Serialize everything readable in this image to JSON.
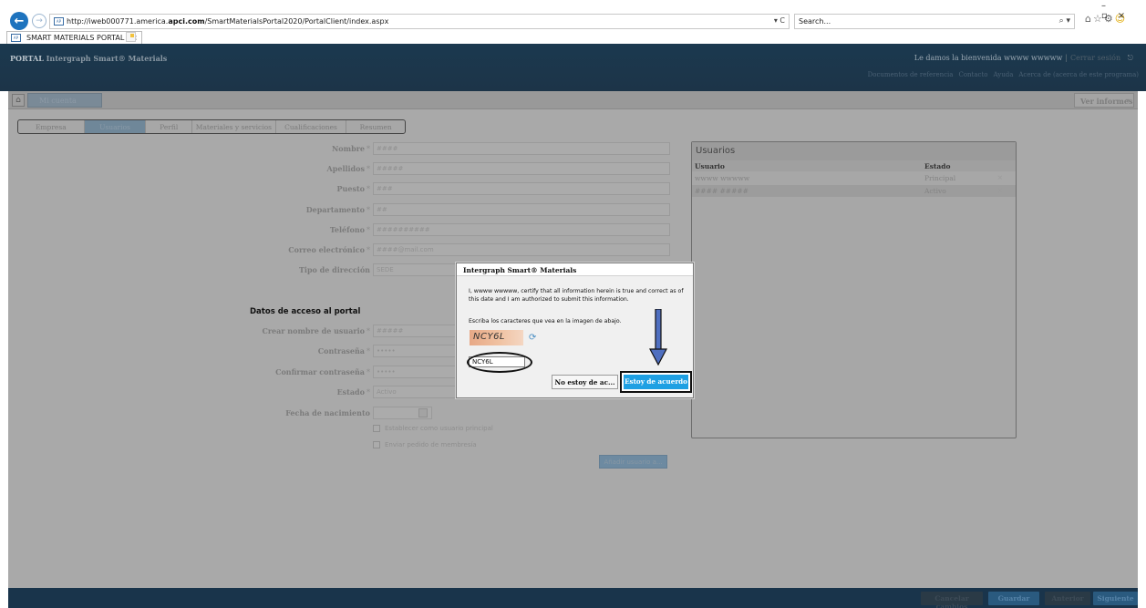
{
  "browser": {
    "url_prefix": "http://iweb000771.america.",
    "url_domain": "apci.com",
    "url_path": "/SmartMaterialsPortal2020/PortalClient/index.aspx",
    "url_controls": "▾ C",
    "search_placeholder": "Search...",
    "tab_title": "SMART MATERIALS PORTAL",
    "tab_close": "×",
    "window_controls": [
      "–",
      "▫",
      "×"
    ]
  },
  "header": {
    "brand_portal": "PORTAL",
    "brand_name": "Intergraph Smart® Materials",
    "welcome": "Le damos la bienvenida wwww wwwww",
    "separator": "|",
    "logout": "Cerrar sesión",
    "links": [
      "Documentos de referencia",
      "Contacto",
      "Ayuda",
      "Acerca de (acerca de este programa)"
    ]
  },
  "toolbar": {
    "home_tab": "Mi cuenta",
    "reports": "Ver informes"
  },
  "steps": [
    "Empresa",
    "Usuarios",
    "Perfil",
    "Materiales y servicios",
    "Cualificaciones",
    "Resumen"
  ],
  "form": {
    "fields": [
      {
        "label": "Nombre",
        "req": "*",
        "value": "####"
      },
      {
        "label": "Apellidos",
        "req": "*",
        "value": "#####"
      },
      {
        "label": "Puesto",
        "req": "*",
        "value": "###"
      },
      {
        "label": "Departamento",
        "req": "*",
        "value": "##"
      },
      {
        "label": "Teléfono",
        "req": "*",
        "value": "##########"
      },
      {
        "label": "Correo electrónico",
        "req": "*",
        "value": "####@mail.com"
      },
      {
        "label": "Tipo de dirección",
        "req": "",
        "value": "SEDE"
      }
    ],
    "section_title": "Datos de acceso al portal",
    "access_fields": [
      {
        "label": "Crear nombre de usuario",
        "req": "*",
        "value": "#####"
      },
      {
        "label": "Contraseña",
        "req": "*",
        "value": "•••••"
      },
      {
        "label": "Confirmar contraseña",
        "req": "*",
        "value": "•••••"
      },
      {
        "label": "Estado",
        "req": "*",
        "value": "Activo"
      },
      {
        "label": "Fecha de nacimiento",
        "req": "",
        "value": ""
      }
    ],
    "checkbox_1": "Establecer como usuario principal",
    "checkbox_2": "Enviar pedido de membresía",
    "add_user": "Añadir usuario a..."
  },
  "users_panel": {
    "title": "Usuarios",
    "col_user": "Usuario",
    "col_state": "Estado",
    "rows": [
      {
        "user": "wwww wwwww",
        "state": "Principal",
        "x": "×"
      },
      {
        "user": "#### #####",
        "state": "Activo",
        "x": "×"
      }
    ]
  },
  "footer": {
    "cancel": "Cancelar cambios",
    "save": "Guardar",
    "previous": "Anterior",
    "next": "Siguiente"
  },
  "dialog": {
    "title": "Intergraph Smart® Materials",
    "body": "I, wwww wwwww, certify that all information herein is true and correct as of this date and I am authorized to submit this information.",
    "prompt": "Escriba los caracteres que vea en la imagen de abajo.",
    "captcha_text": "NCY6L",
    "captcha_input": "NCY6L",
    "decline": "No estoy de ac...",
    "accept": "Estoy de acuerdo"
  },
  "colors": {
    "accent": "#1ea0e3",
    "header": "#1b394f",
    "annotation_arrow": "#4f6fc0"
  }
}
